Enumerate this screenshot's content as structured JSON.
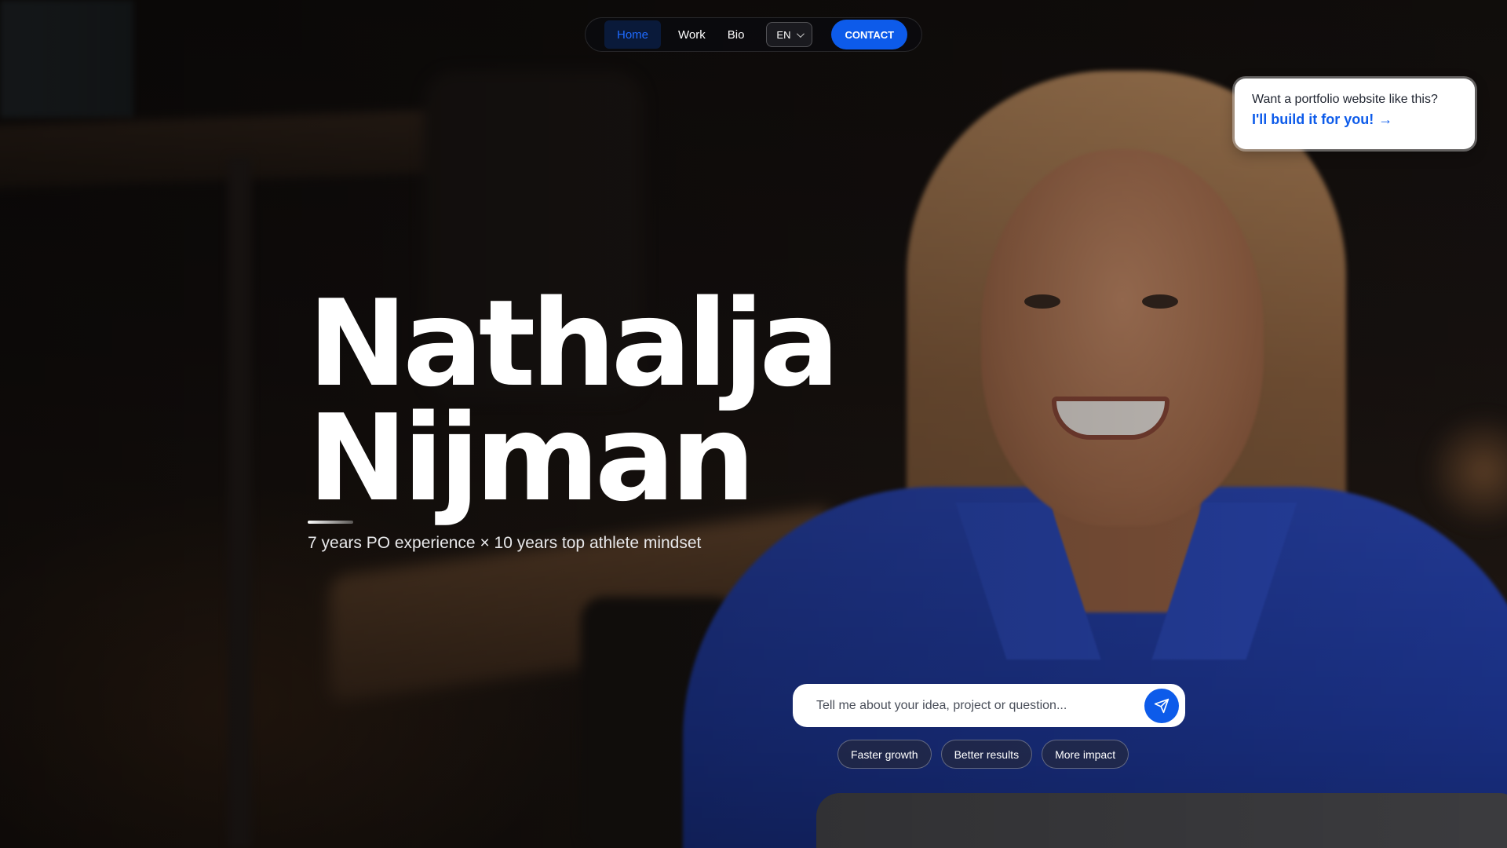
{
  "nav": {
    "items": [
      {
        "label": "Home",
        "active": true
      },
      {
        "label": "Work"
      },
      {
        "label": "Bio"
      }
    ],
    "language": "EN",
    "contact_label": "CONTACT"
  },
  "promo": {
    "question": "Want a portfolio website like this?",
    "cta": "I'll build it for you!",
    "cta_icon": "arrow-right-icon"
  },
  "hero": {
    "first_name": "Nathalja",
    "last_name": "Nijman",
    "tagline": "7 years PO experience × 10 years top athlete mindset"
  },
  "chat": {
    "placeholder": "Tell me about your idea, project or question...",
    "value": "",
    "send_icon": "send-icon"
  },
  "chips": [
    "Faster growth",
    "Better results",
    "More impact"
  ],
  "colors": {
    "accent": "#0d5bea",
    "nav_bg": "#0a0a0e"
  }
}
